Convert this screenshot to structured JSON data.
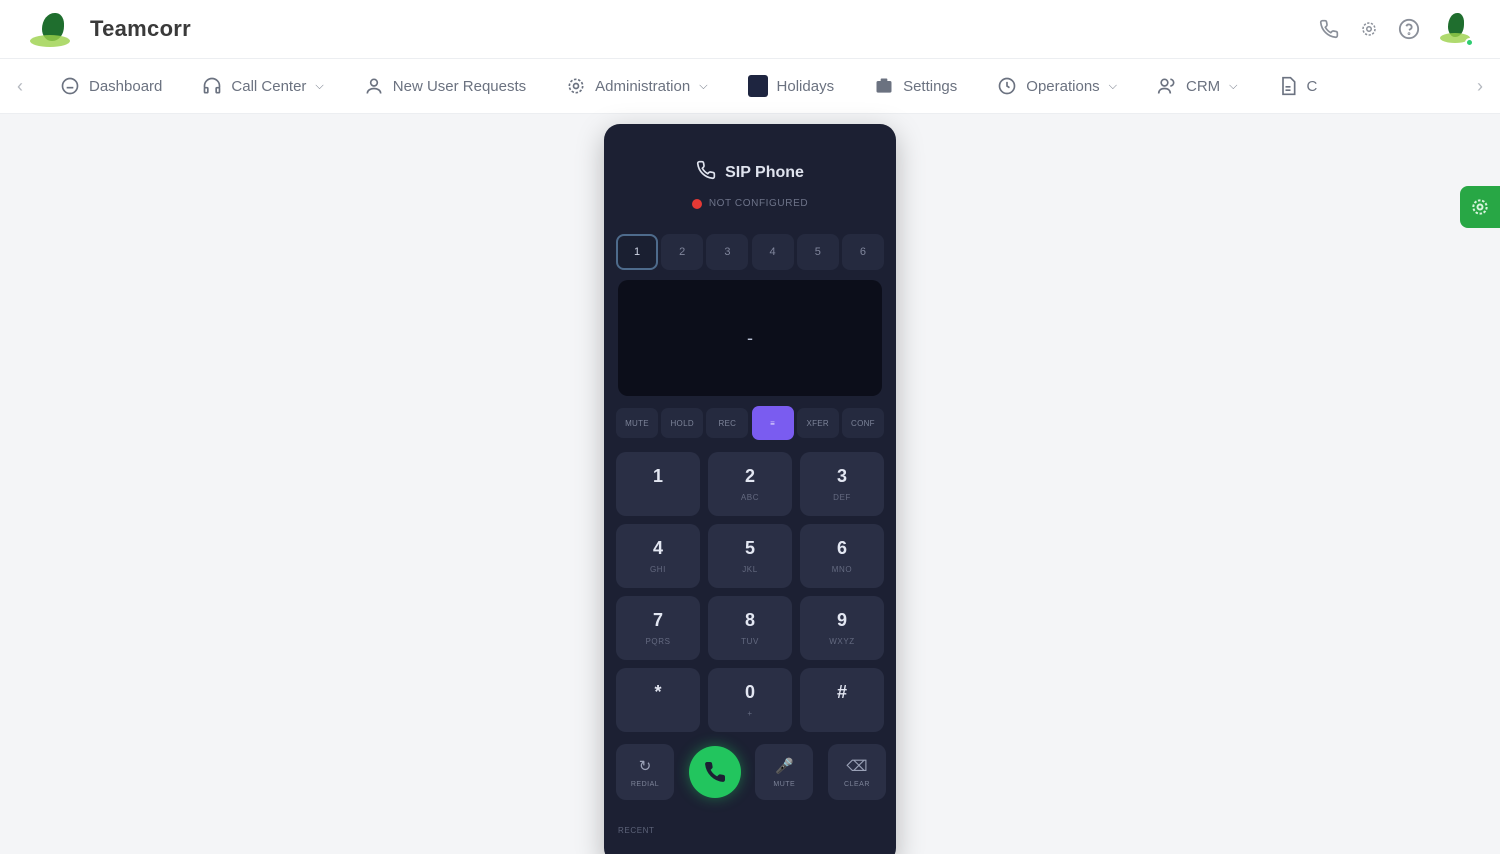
{
  "app": {
    "brand": "Teamcorr"
  },
  "nav": {
    "items": [
      {
        "label": "Dashboard",
        "has_dropdown": false,
        "icon": "home-icon"
      },
      {
        "label": "Call Center",
        "has_dropdown": true,
        "icon": "headset-icon"
      },
      {
        "label": "New User Requests",
        "has_dropdown": false,
        "icon": "user-icon"
      },
      {
        "label": "Administration",
        "has_dropdown": true,
        "icon": "gear-icon"
      },
      {
        "label": "Holidays",
        "has_dropdown": false,
        "icon": "calendar-icon"
      },
      {
        "label": "Settings",
        "has_dropdown": false,
        "icon": "settings-icon"
      },
      {
        "label": "Operations",
        "has_dropdown": true,
        "icon": "clock-icon"
      },
      {
        "label": "CRM",
        "has_dropdown": true,
        "icon": "users-icon"
      },
      {
        "label": "C",
        "has_dropdown": false,
        "icon": "document-icon"
      }
    ]
  },
  "phone": {
    "title": "SIP Phone",
    "status": "NOT CONFIGURED",
    "lines": [
      "1",
      "2",
      "3",
      "4",
      "5",
      "6"
    ],
    "display": "-",
    "functions": [
      "MUTE",
      "HOLD",
      "REC",
      "≡",
      "XFER",
      "CONF"
    ],
    "keys": [
      {
        "digit": "1",
        "letters": ""
      },
      {
        "digit": "2",
        "letters": "ABC"
      },
      {
        "digit": "3",
        "letters": "DEF"
      },
      {
        "digit": "4",
        "letters": "GHI"
      },
      {
        "digit": "5",
        "letters": "JKL"
      },
      {
        "digit": "6",
        "letters": "MNO"
      },
      {
        "digit": "7",
        "letters": "PQRS"
      },
      {
        "digit": "8",
        "letters": "TUV"
      },
      {
        "digit": "9",
        "letters": "WXYZ"
      },
      {
        "digit": "*",
        "letters": ""
      },
      {
        "digit": "0",
        "letters": "+"
      },
      {
        "digit": "#",
        "letters": ""
      }
    ],
    "bottom": {
      "redial": "REDIAL",
      "mute": "MUTE",
      "clear": "CLEAR"
    },
    "recent_label": "RECENT"
  },
  "colors": {
    "accent_purple": "#7a5cf0",
    "call_green": "#22c55e",
    "status_red": "#e53935",
    "phone_bg": "#1c2033"
  }
}
